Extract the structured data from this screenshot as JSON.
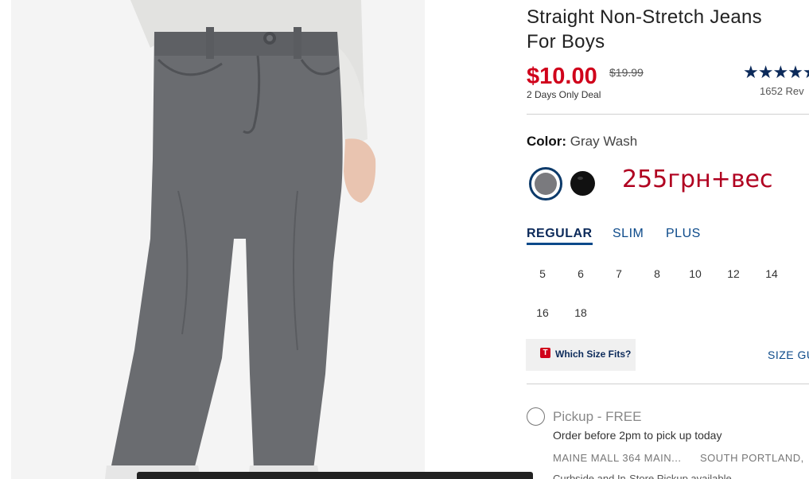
{
  "product": {
    "title": "Straight Non-Stretch Jeans\nFor Boys",
    "price": "$10.00",
    "old_price": "$19.99",
    "deal_text": "2 Days Only Deal",
    "rating_stars": "★★★★★",
    "reviews": "1652 Rev"
  },
  "color": {
    "label": "Color:",
    "value": "Gray Wash",
    "swatches": [
      {
        "name": "Gray Wash",
        "hex": "#7a7a7e",
        "selected": true
      },
      {
        "name": "Black",
        "hex": "#111111",
        "selected": false
      }
    ]
  },
  "annotation": "255грн+вес",
  "fit_tabs": [
    {
      "label": "REGULAR",
      "active": true
    },
    {
      "label": "SLIM",
      "active": false
    },
    {
      "label": "PLUS",
      "active": false
    }
  ],
  "sizes": [
    "5",
    "6",
    "7",
    "8",
    "10",
    "12",
    "14",
    "16",
    "18"
  ],
  "size_help": {
    "icon_letter": "T",
    "label": "Which Size Fits?",
    "guide_link": "SIZE GU"
  },
  "fulfillment": {
    "pickup_label": "Pickup - FREE",
    "pickup_note": "Order before 2pm to pick up today",
    "store": "MAINE MALL 364 MAIN...",
    "city": "SOUTH PORTLAND,",
    "cutoff_text": "Curbside and In-Store Pickup available"
  },
  "colors": {
    "price_red": "#d0021b",
    "navy": "#0c2a5a",
    "link_blue": "#0c4a8a"
  }
}
